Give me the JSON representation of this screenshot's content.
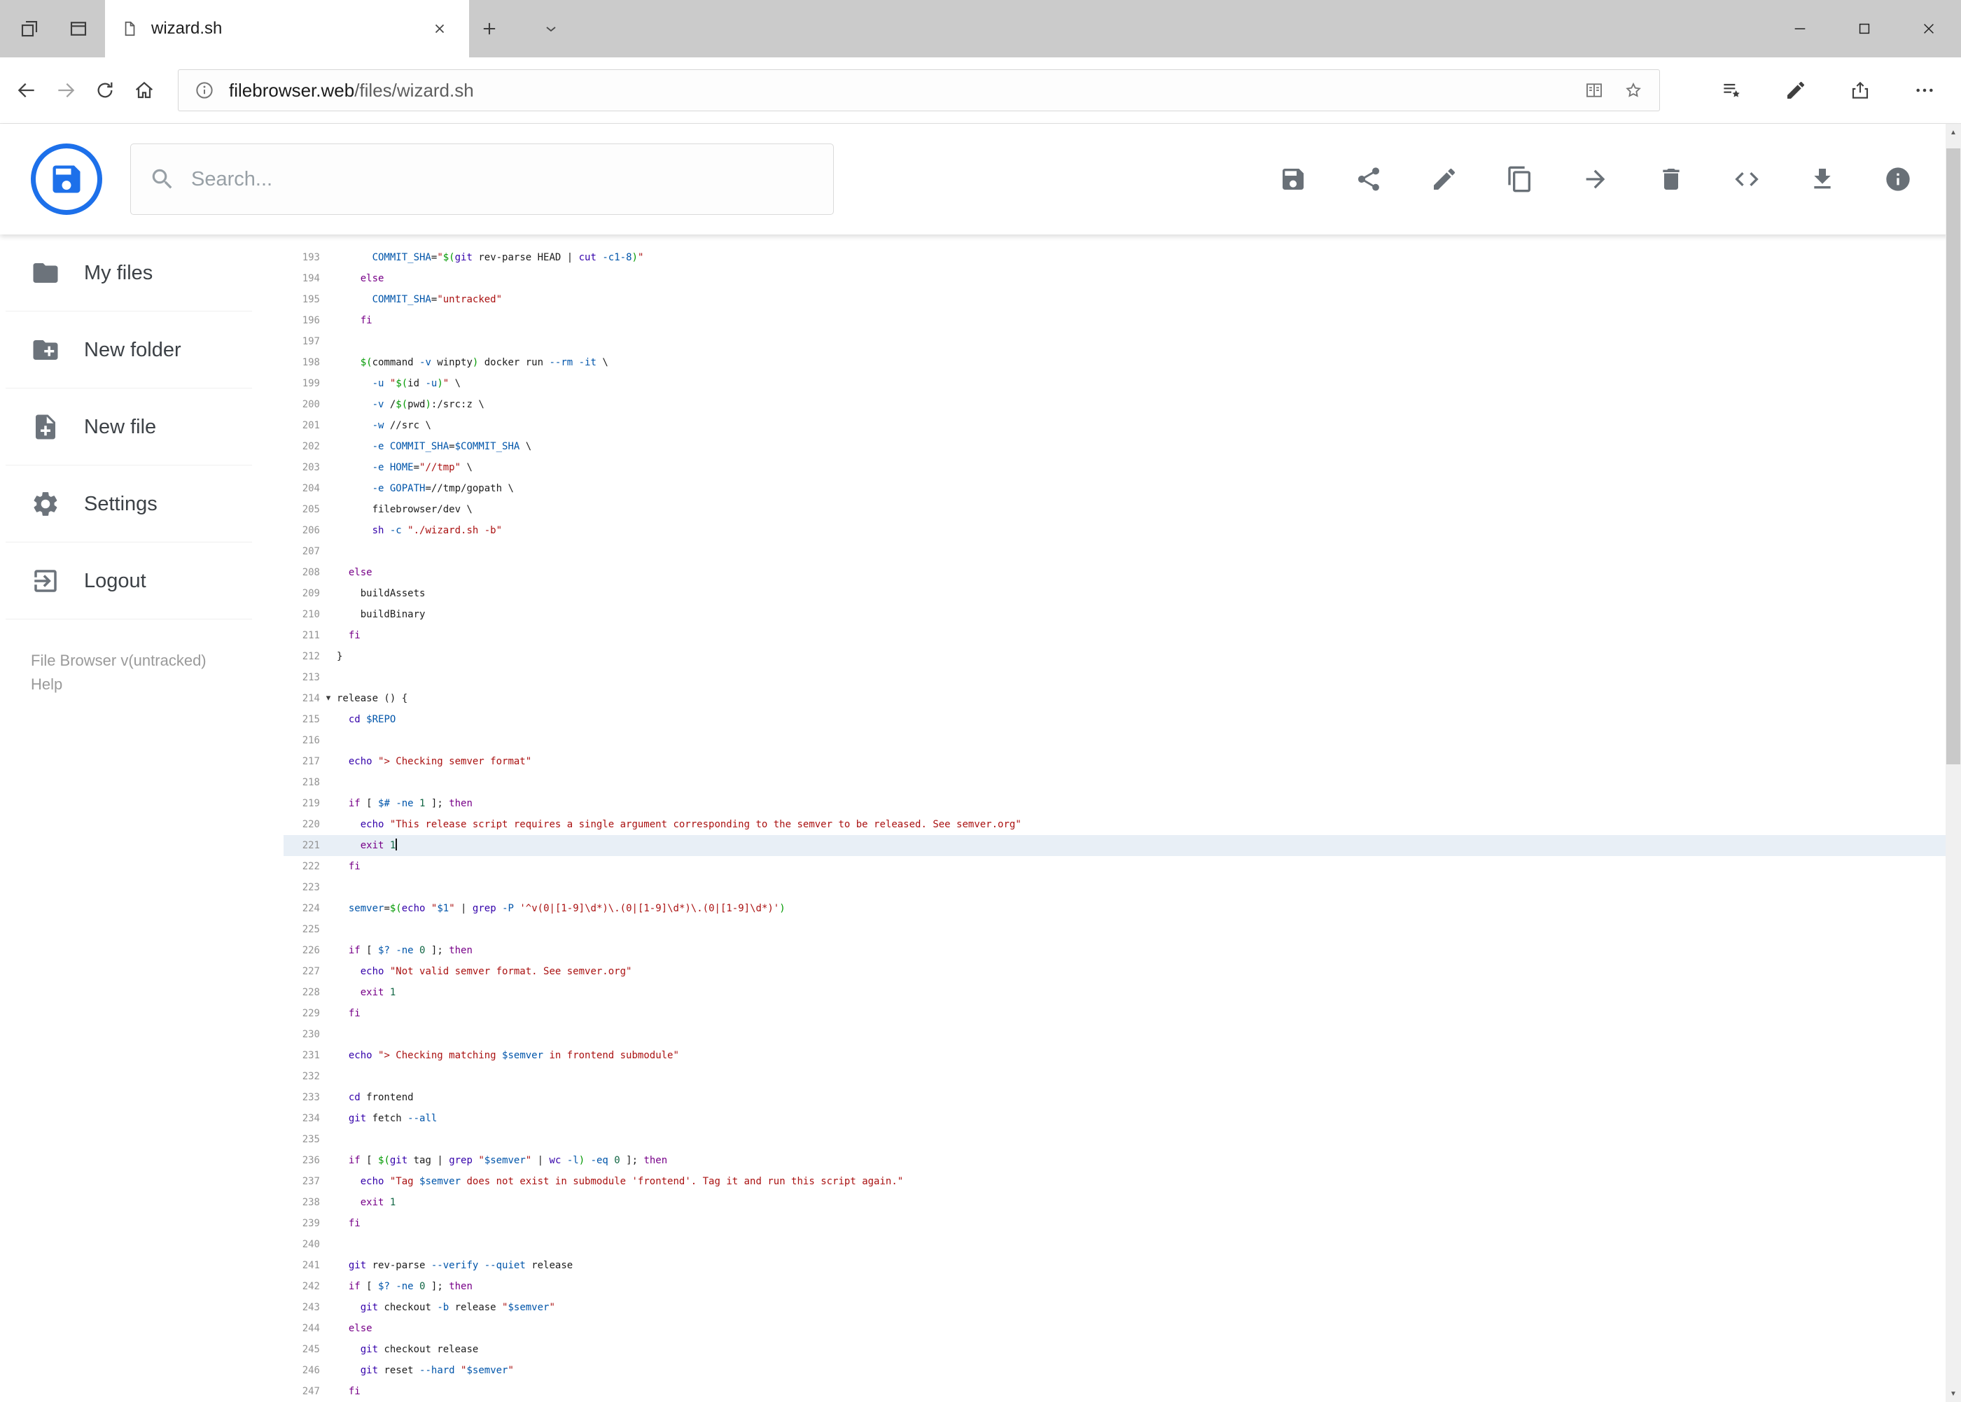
{
  "browser": {
    "tab_title": "wizard.sh",
    "url_domain": "filebrowser.web",
    "url_path": "/files/wizard.sh"
  },
  "header": {
    "search_placeholder": "Search...",
    "toolbar_icons": [
      "save",
      "share",
      "edit",
      "copy",
      "move",
      "delete",
      "raw-code",
      "download",
      "info"
    ]
  },
  "sidebar": {
    "items": [
      {
        "icon": "folder",
        "label": "My files"
      },
      {
        "icon": "create-new-folder",
        "label": "New folder"
      },
      {
        "icon": "note-add",
        "label": "New file"
      },
      {
        "icon": "settings",
        "label": "Settings"
      },
      {
        "icon": "logout",
        "label": "Logout"
      }
    ],
    "footer_version": "File Browser v(untracked)",
    "footer_help": "Help"
  },
  "editor": {
    "language": "shell",
    "first_line": 193,
    "active_line": 221,
    "fold_marker_line": 214,
    "lines": [
      "      COMMIT_SHA=\"$(git rev-parse HEAD | cut -c1-8)\"",
      "    else",
      "      COMMIT_SHA=\"untracked\"",
      "    fi",
      "",
      "    $(command -v winpty) docker run --rm -it \\",
      "      -u \"$(id -u)\" \\",
      "      -v /$(pwd):/src:z \\",
      "      -w //src \\",
      "      -e COMMIT_SHA=$COMMIT_SHA \\",
      "      -e HOME=\"//tmp\" \\",
      "      -e GOPATH=//tmp/gopath \\",
      "      filebrowser/dev \\",
      "      sh -c \"./wizard.sh -b\"",
      "",
      "  else",
      "    buildAssets",
      "    buildBinary",
      "  fi",
      "}",
      "",
      "release () {",
      "  cd $REPO",
      "",
      "  echo \"> Checking semver format\"",
      "",
      "  if [ $# -ne 1 ]; then",
      "    echo \"This release script requires a single argument corresponding to the semver to be released. See semver.org\"",
      "    exit 1",
      "  fi",
      "",
      "  semver=$(echo \"$1\" | grep -P '^v(0|[1-9]\\d*)\\.(0|[1-9]\\d*)\\.(0|[1-9]\\d*)')",
      "",
      "  if [ $? -ne 0 ]; then",
      "    echo \"Not valid semver format. See semver.org\"",
      "    exit 1",
      "  fi",
      "",
      "  echo \"> Checking matching $semver in frontend submodule\"",
      "",
      "  cd frontend",
      "  git fetch --all",
      "",
      "  if [ $(git tag | grep \"$semver\" | wc -l) -eq 0 ]; then",
      "    echo \"Tag $semver does not exist in submodule 'frontend'. Tag it and run this script again.\"",
      "    exit 1",
      "  fi",
      "",
      "  git rev-parse --verify --quiet release",
      "  if [ $? -ne 0 ]; then",
      "    git checkout -b release \"$semver\"",
      "  else",
      "    git checkout release",
      "    git reset --hard \"$semver\"",
      "  fi"
    ]
  },
  "colors": {
    "brand_blue": "#1d70ea",
    "tabbar_bg": "#cbcbcb",
    "active_line_bg": "#e8eff6",
    "syntax": {
      "keyword": "#770088",
      "builtin": "#3300aa",
      "string": "#aa1111",
      "variable": "#0055aa",
      "attribute": "#0055aa",
      "number": "#116644",
      "quote": "#009900"
    }
  }
}
